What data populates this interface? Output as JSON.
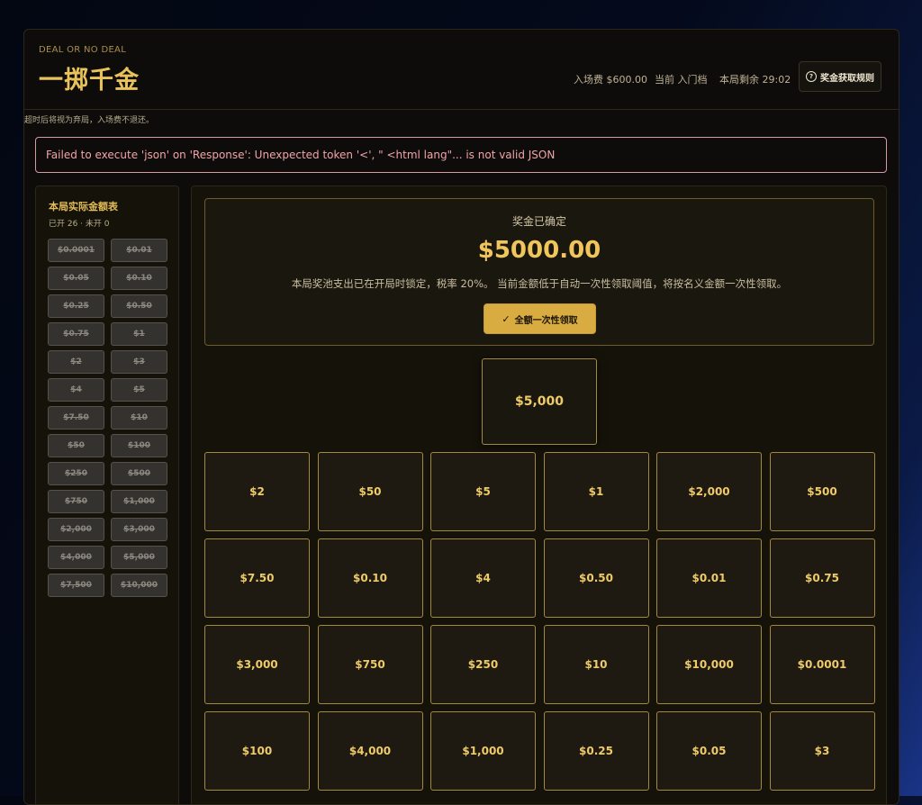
{
  "header": {
    "eyebrow": "DEAL OR NO DEAL",
    "title": "一掷千金",
    "entry_fee": "入场费 $600.00",
    "tier": "当前 入门档",
    "time_left": "本局剩余 29:02",
    "rules_button": "奖金获取规则",
    "rules_icon": "?"
  },
  "timeout_note": "超时后将视为弃局，入场费不退还。",
  "error_message": "Failed to execute 'json' on 'Response': Unexpected token '<', \" <html lang\"... is not valid JSON",
  "sidebar": {
    "title": "本局实际金额表",
    "subtitle": "已开 26 · 未开 0",
    "values": [
      "$0.0001",
      "$0.01",
      "$0.05",
      "$0.10",
      "$0.25",
      "$0.50",
      "$0.75",
      "$1",
      "$2",
      "$3",
      "$4",
      "$5",
      "$7.50",
      "$10",
      "$50",
      "$100",
      "$250",
      "$500",
      "$750",
      "$1,000",
      "$2,000",
      "$3,000",
      "$4,000",
      "$5,000",
      "$7,500",
      "$10,000"
    ]
  },
  "prize": {
    "label": "奖金已确定",
    "amount": "$5000.00",
    "description": "本局奖池支出已在开局时锁定，税率 20%。 当前金额低于自动一次性领取阈值，将按名义金额一次性领取。",
    "claim_button": "全额一次性领取",
    "claim_icon": "✓"
  },
  "my_case": "$5,000",
  "cases": [
    "$2",
    "$50",
    "$5",
    "$1",
    "$2,000",
    "$500",
    "$7.50",
    "$0.10",
    "$4",
    "$0.50",
    "$0.01",
    "$0.75",
    "$3,000",
    "$750",
    "$250",
    "$10",
    "$10,000",
    "$0.0001",
    "$100",
    "$4,000",
    "$1,000",
    "$0.25",
    "$0.05",
    "$3"
  ],
  "colors": {
    "accent_gold": "#e8c25a",
    "error_text": "#f1a4a8",
    "panel_bg": "#141209"
  }
}
